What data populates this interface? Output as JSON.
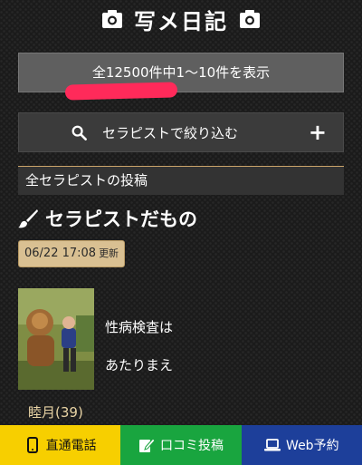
{
  "header": {
    "title": "写メ日記",
    "left_icon": "camera-icon",
    "right_icon": "camera-icon"
  },
  "summary": {
    "text": "全12500件中1〜10件を表示"
  },
  "filter": {
    "label": "セラピストで絞り込む",
    "icon": "search-icon",
    "toggle": "+"
  },
  "section": {
    "title": "全セラピストの投稿"
  },
  "heading": {
    "text": "セラピストだもの",
    "icon": "brush-icon"
  },
  "post": {
    "date": "06/22 17:08",
    "updated_label": "更新",
    "lines": [
      "性病検査は",
      "あたりまえ"
    ],
    "author": "睦月(39)"
  },
  "bottom_bar": [
    {
      "label": "直通電話",
      "icon": "phone-icon",
      "color": "#f7cf00"
    },
    {
      "label": "口コミ投稿",
      "icon": "edit-icon",
      "color": "#19a53f"
    },
    {
      "label": "Web予約",
      "icon": "laptop-icon",
      "color": "#1d3f9a"
    }
  ]
}
